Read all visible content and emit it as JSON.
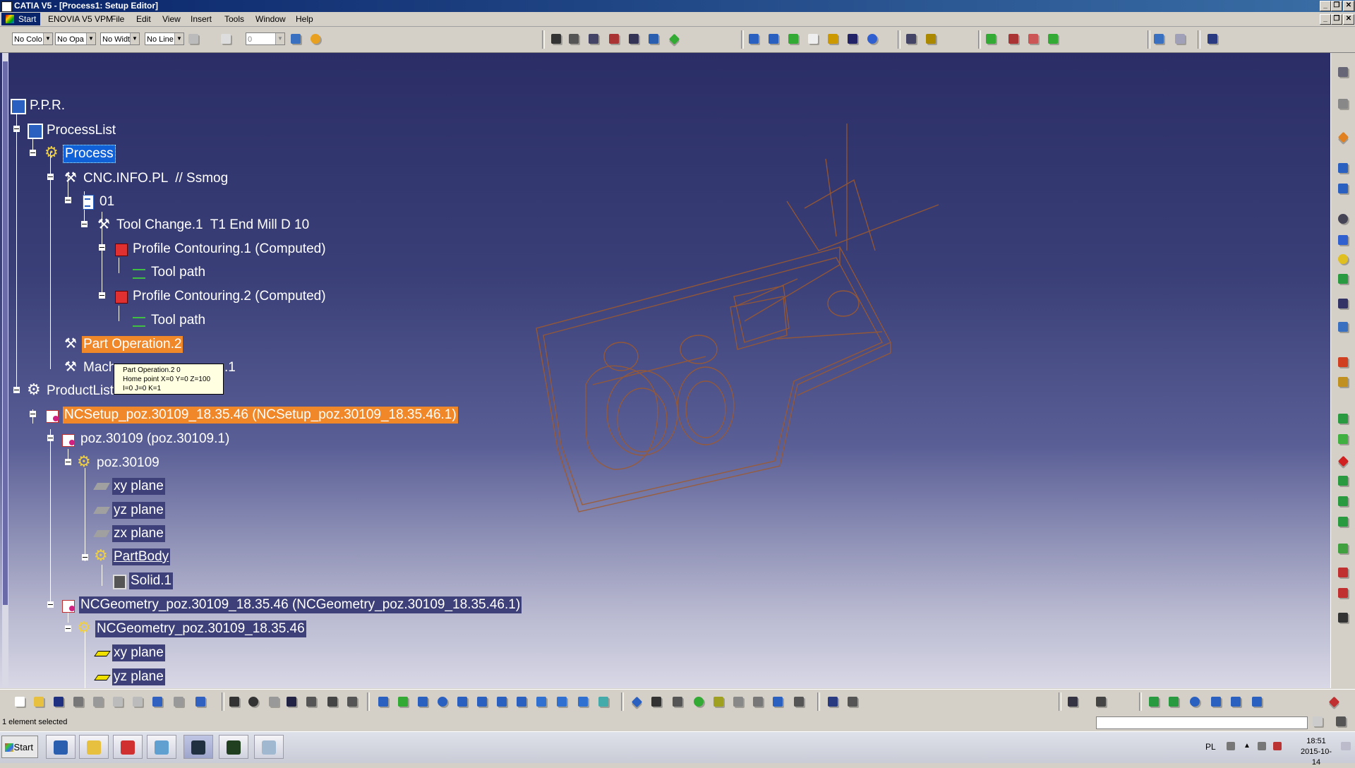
{
  "window": {
    "title": "CATIA V5 - [Process1: Setup Editor]",
    "controls": {
      "minimize": "_",
      "restore": "❐",
      "close": "✕"
    }
  },
  "menu": {
    "start": "Start",
    "items": [
      "ENOVIA V5 VPM",
      "File",
      "Edit",
      "View",
      "Insert",
      "Tools",
      "Window",
      "Help"
    ]
  },
  "toolbar_top": {
    "color_combo": "No Colo",
    "opacity_combo": "No Opa",
    "width_combo": "No Widt",
    "linetype_combo": "No Line",
    "layer_value": "0"
  },
  "tree": {
    "ppr": "P.P.R.",
    "process_list": "ProcessList",
    "process": "Process",
    "cnc": "CNC.INFO.PL  // Ssmog",
    "program": "01",
    "tool_change": "Tool Change.1  T1 End Mill D 10",
    "profile1": "Profile Contouring.1 (Computed)",
    "toolpath1": "Tool path",
    "profile2": "Profile Contouring.2 (Computed)",
    "toolpath2": "Tool path",
    "part_op": "Part Operation.2",
    "mach_a": "Mach",
    "mach_b": ".1",
    "product_list": "ProductList",
    "ncsetup": "NCSetup_poz.30109_18.35.46 (NCSetup_poz.30109_18.35.46.1)",
    "poz_inst": "poz.30109 (poz.30109.1)",
    "poz": "poz.30109",
    "xy": "xy plane",
    "yz": "yz plane",
    "zx": "zx plane",
    "partbody": "PartBody",
    "solid": "Solid.1",
    "ncgeom_inst": "NCGeometry_poz.30109_18.35.46 (NCGeometry_poz.30109_18.35.46.1)",
    "ncgeom": "NCGeometry_poz.30109_18.35.46",
    "xy2": "xy plane",
    "yz2": "yz plane"
  },
  "tooltip": {
    "line1": "Part Operation.2 0",
    "line2": "Home point X=0 Y=0 Z=100",
    "line3": "I=0 J=0 K=1"
  },
  "status": {
    "message": "1 element selected"
  },
  "taskbar": {
    "start": "Start",
    "language": "PL",
    "time": "18:51",
    "date": "2015-10-14"
  },
  "colors": {
    "selection": "#1060d8",
    "highlight_orange": "#f0882a",
    "wireframe": "#a05a2c"
  }
}
